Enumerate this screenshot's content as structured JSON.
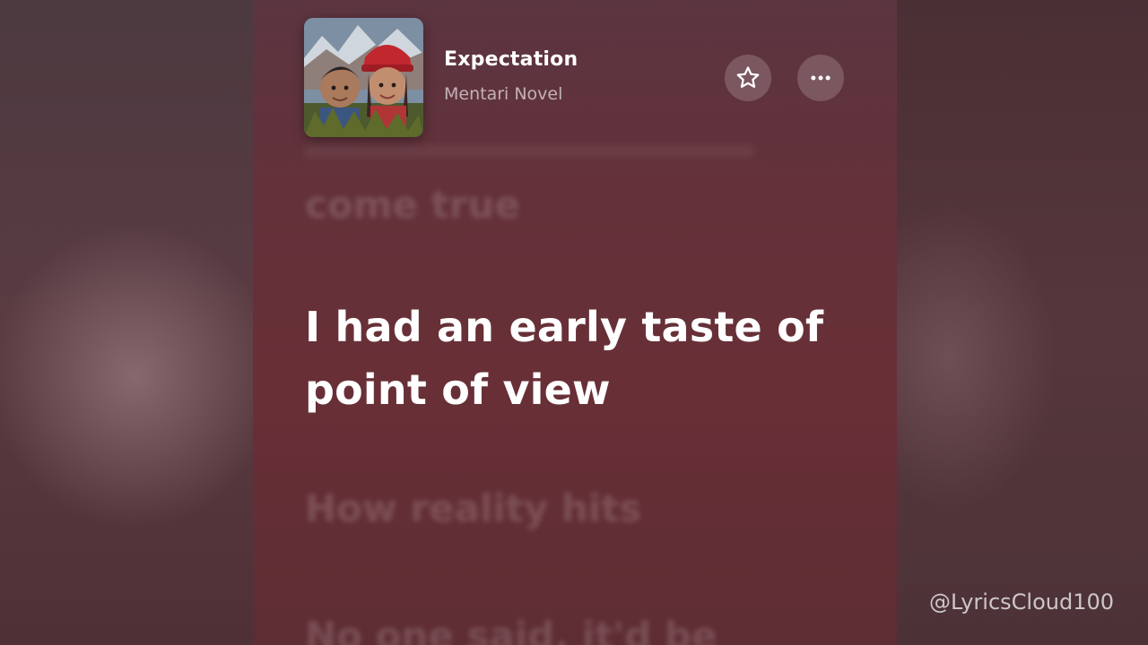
{
  "now_playing": {
    "title": "Expectation",
    "artist": "Mentari Novel"
  },
  "actions": {
    "favorite_icon": "star-outline-icon",
    "more_icon": "ellipsis-icon"
  },
  "lyrics": {
    "previous": "come true",
    "current": "I had an early taste of point of view",
    "next": "How reality hits",
    "next_2": "No one said, it'd be"
  },
  "watermark": "@LyricsCloud100",
  "colors": {
    "background": "#5f2a30",
    "text_primary": "#ffffff"
  }
}
